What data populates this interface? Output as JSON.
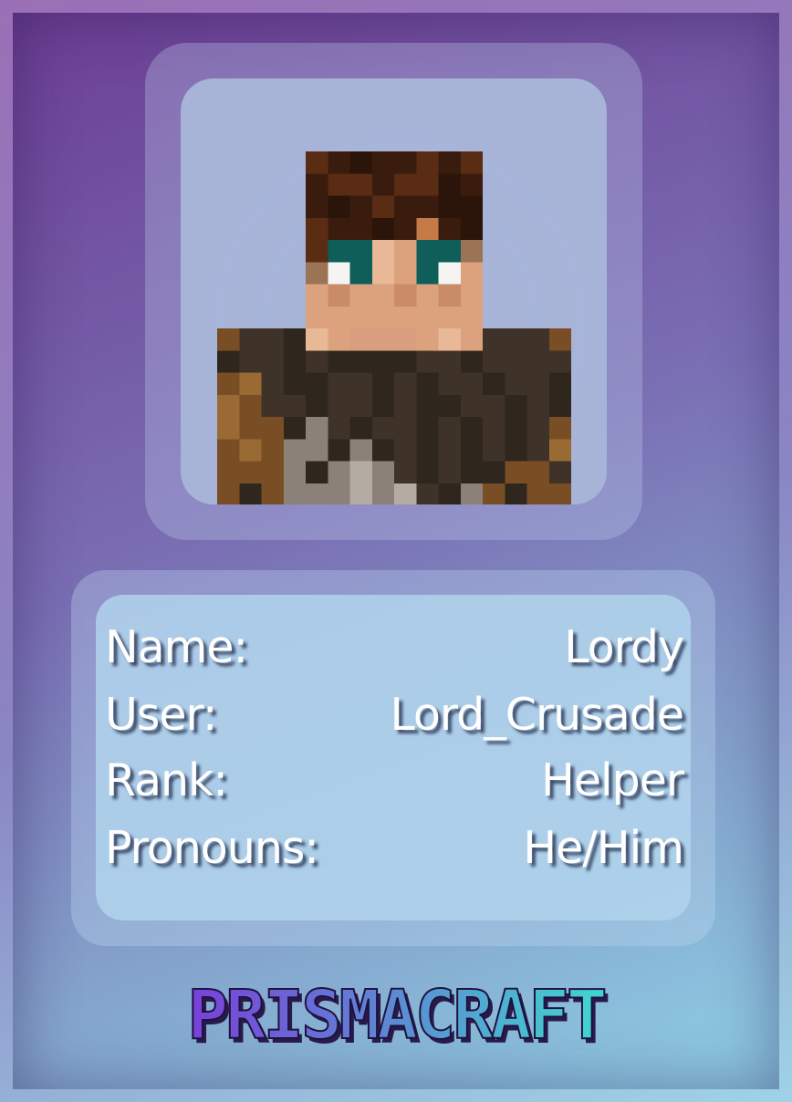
{
  "profile": {
    "fields": [
      {
        "label": "Name:",
        "value": "Lordy"
      },
      {
        "label": "User:",
        "value": "Lord_Crusade"
      },
      {
        "label": "Rank:",
        "value": "Helper"
      },
      {
        "label": "Pronouns:",
        "value": "He/Him"
      }
    ]
  },
  "logo": {
    "text": "PRISMACRAFT"
  },
  "colors": {
    "hair": "#3a1c0e",
    "skin": "#dca27e",
    "eyes": "#0f5e5a",
    "armor": "#3f3228",
    "leather": "#7a4e24",
    "chain": "#8c8178",
    "logo_start": "#7a3fd8",
    "logo_end": "#3fd7cf"
  }
}
